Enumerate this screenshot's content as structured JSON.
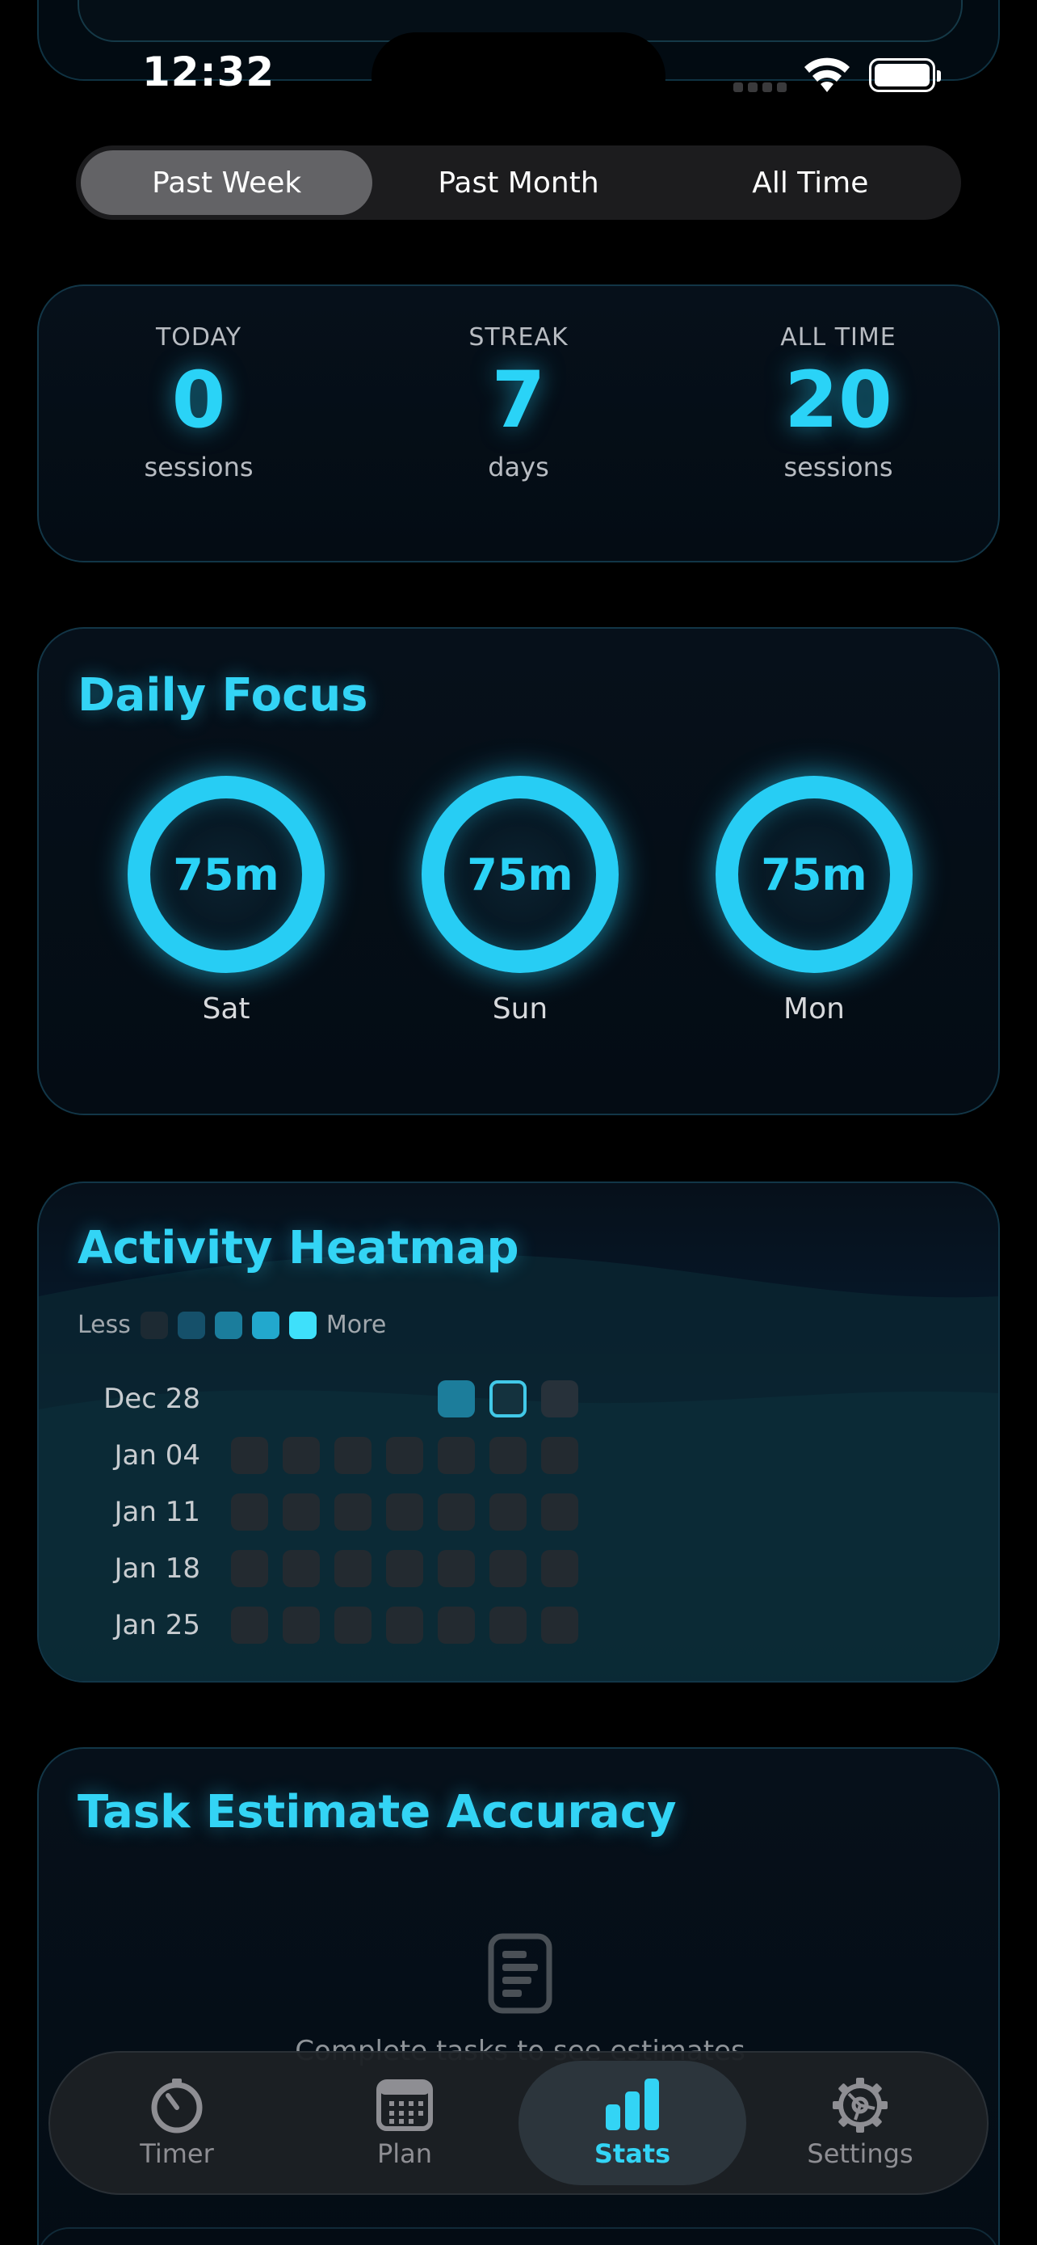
{
  "status_bar": {
    "time": "12:32"
  },
  "segmented": {
    "options": [
      "Past Week",
      "Past Month",
      "All Time"
    ],
    "selected": "Past Week"
  },
  "summary": [
    {
      "label": "TODAY",
      "value": "0",
      "unit": "sessions"
    },
    {
      "label": "STREAK",
      "value": "7",
      "unit": "days"
    },
    {
      "label": "ALL TIME",
      "value": "20",
      "unit": "sessions"
    }
  ],
  "daily_focus": {
    "title": "Daily Focus",
    "days": [
      {
        "value": "75m",
        "day": "Sat"
      },
      {
        "value": "75m",
        "day": "Sun"
      },
      {
        "value": "75m",
        "day": "Mon"
      }
    ]
  },
  "heatmap": {
    "title": "Activity Heatmap",
    "legend_less": "Less",
    "legend_more": "More",
    "legend_colors": [
      "#1d2a33",
      "#15506a",
      "#1b7d9c",
      "#22a8cd",
      "#3ee0fb"
    ],
    "weeks": [
      "Dec 28",
      "Jan 04",
      "Jan 11",
      "Jan 18",
      "Jan 25"
    ],
    "first_week_levels": [
      "none",
      "none",
      "none",
      "none",
      "2",
      "today",
      "0"
    ]
  },
  "task_accuracy": {
    "title": "Task Estimate Accuracy",
    "empty_icon": "document-list-icon",
    "empty_text": "Complete tasks to see estimates"
  },
  "tabbar": {
    "tabs": [
      {
        "label": "Timer",
        "icon": "timer-icon"
      },
      {
        "label": "Plan",
        "icon": "calendar-icon"
      },
      {
        "label": "Stats",
        "icon": "bar-chart-icon"
      },
      {
        "label": "Settings",
        "icon": "gear-icon"
      }
    ],
    "active": "Stats"
  },
  "colors": {
    "accent": "#33d4f5",
    "background": "#000000",
    "card_border": "#123647"
  }
}
